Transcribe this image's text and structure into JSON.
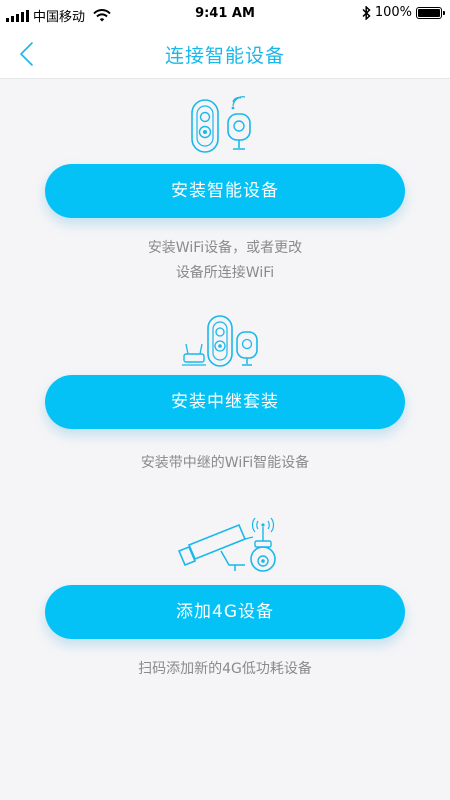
{
  "status_bar": {
    "carrier": "中国移动",
    "time": "9:41 AM",
    "battery": "100%",
    "battery_level": 1.0
  },
  "nav": {
    "title": "连接智能设备",
    "back_icon": "chevron-left-icon"
  },
  "sections": [
    {
      "button_label": "安装智能设备",
      "desc_lines": [
        "安装WiFi设备，或者更改",
        "设备所连接WiFi"
      ],
      "icon": "doorbell-camera-icon"
    },
    {
      "button_label": "安装中继套装",
      "desc_lines": [
        "安装带中继的WiFi智能设备"
      ],
      "icon": "repeater-kit-icon"
    },
    {
      "button_label": "添加4G设备",
      "desc_lines": [
        "扫码添加新的4G低功耗设备"
      ],
      "icon": "4g-camera-icon"
    }
  ],
  "colors": {
    "accent": "#1ab8ea",
    "button": "#05c2f6",
    "background": "#f5f5f7",
    "desc_text": "#8a8a8a"
  }
}
